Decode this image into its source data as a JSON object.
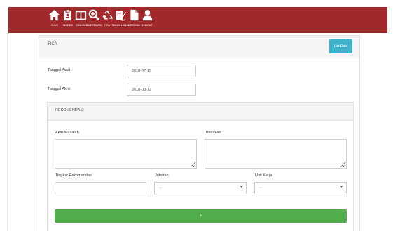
{
  "nav": {
    "items": [
      {
        "label": "HOME",
        "icon": "home-icon"
      },
      {
        "label": "INSIDEN",
        "icon": "clipboard-icon"
      },
      {
        "label": "GRADING",
        "icon": "book-icon"
      },
      {
        "label": "INVESTIGASI",
        "icon": "magnifier-plus-icon"
      },
      {
        "label": "RCA",
        "icon": "recycle-icon"
      },
      {
        "label": "TINDAK LANJUT",
        "icon": "signature-icon"
      },
      {
        "label": "LAPORAN",
        "icon": "document-icon"
      },
      {
        "label": "LOGOUT",
        "icon": "user-icon"
      }
    ],
    "bg_color": "#a1292c"
  },
  "panel": {
    "title": "RCA",
    "list_button": "List Data"
  },
  "form": {
    "tanggal_awal_label": "Tanggal Awal",
    "tanggal_awal_value": "2018-07-15",
    "tanggal_akhir_label": "Tanggal Akhir",
    "tanggal_akhir_value": "2018-08-12"
  },
  "rekomendasi": {
    "title": "REKOMENDASI",
    "akar_masalah_label": "Akar Masalah",
    "tindakan_label": "Tindakan",
    "tingkat_label": "Tingkat Rekomendasi",
    "jabatan_label": "Jabatan",
    "jabatan_value": "-",
    "unit_kerja_label": "Unit Kerja",
    "unit_kerja_value": "-",
    "submit_label": "+"
  },
  "colors": {
    "info_button": "#3fb2c9",
    "success_button": "#4fae49"
  }
}
